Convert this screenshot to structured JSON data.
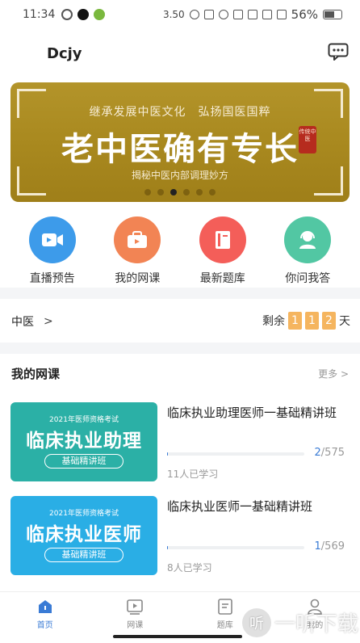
{
  "status_bar": {
    "time": "11:34",
    "speed": "3.50",
    "battery": "56%"
  },
  "header": {
    "brand": "Dcjy"
  },
  "banner": {
    "subtitle": "继承发展中医文化　弘扬国医国粹",
    "title": "老中医确有专长",
    "seal": "传统中医",
    "tagline": "揭秘中医内部调理妙方",
    "slide_count": 6,
    "active_slide": 2
  },
  "shortcuts": [
    {
      "label": "直播预告",
      "icon": "live-video-icon",
      "color": "#3d9bea"
    },
    {
      "label": "我的网课",
      "icon": "briefcase-icon",
      "color": "#f28454"
    },
    {
      "label": "最新题库",
      "icon": "book-icon",
      "color": "#f45e59"
    },
    {
      "label": "你问我答",
      "icon": "headset-icon",
      "color": "#52c7a3"
    }
  ],
  "subject": {
    "name": "中医",
    "remain_prefix": "剩余",
    "remain_digits": [
      "1",
      "1",
      "2"
    ],
    "remain_suffix": "天"
  },
  "courses": {
    "title": "我的网课",
    "more": "更多",
    "items": [
      {
        "name": "临床执业助理医师一基础精讲班",
        "thumb_top": "2021年医师资格考试",
        "thumb_title": "临床执业助理",
        "thumb_badge": "基础精讲班",
        "thumb_color": "#2bb0a6",
        "progress_done": "2",
        "progress_total": "/575",
        "progress_fraction": 0.0035,
        "learners": "11人已学习"
      },
      {
        "name": "临床执业医师一基础精讲班",
        "thumb_top": "2021年医师资格考试",
        "thumb_title": "临床执业医师",
        "thumb_badge": "基础精讲班",
        "thumb_color": "#2aaee5",
        "progress_done": "1",
        "progress_total": "/569",
        "progress_fraction": 0.0018,
        "learners": "8人已学习"
      }
    ]
  },
  "tabbar": [
    {
      "label": "首页",
      "icon": "home-icon",
      "active": true
    },
    {
      "label": "网课",
      "icon": "play-icon",
      "active": false
    },
    {
      "label": "题库",
      "icon": "document-icon",
      "active": false
    },
    {
      "label": "我的",
      "icon": "user-icon",
      "active": false
    }
  ],
  "watermark": {
    "text": "一听下载",
    "icon": "听"
  },
  "colors": {
    "accent": "#3a7bd5",
    "banner": "#a9891f",
    "countdown": "#f5b55f"
  }
}
